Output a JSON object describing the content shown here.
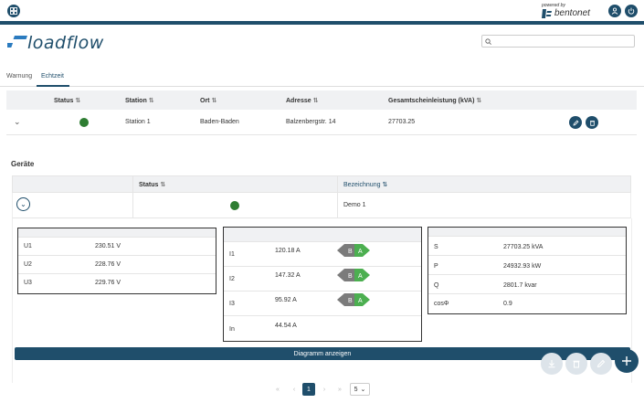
{
  "header": {
    "powered_by": "powered by",
    "brand": "bentonet",
    "app_name": "loadflow",
    "search_placeholder": ""
  },
  "tabs": [
    {
      "label": "Warnung",
      "active": false
    },
    {
      "label": "Echtzeit",
      "active": true
    }
  ],
  "stations_table": {
    "columns": [
      "Status",
      "Station",
      "Ort",
      "Adresse",
      "Gesamtscheinleistung (kVA)"
    ],
    "rows": [
      {
        "status": "green",
        "station": "Station 1",
        "ort": "Baden-Baden",
        "adresse": "Balzenbergstr. 14",
        "leistung": "27703.25"
      }
    ]
  },
  "devices": {
    "title": "Geräte",
    "columns": [
      "Status",
      "Bezeichnung"
    ],
    "rows": [
      {
        "status": "green",
        "bezeichnung": "Demo 1"
      }
    ]
  },
  "voltage": [
    {
      "label": "U1",
      "value": "230.51 V"
    },
    {
      "label": "U2",
      "value": "228.76 V"
    },
    {
      "label": "U3",
      "value": "229.76 V"
    }
  ],
  "current": [
    {
      "label": "I1",
      "value": "120.18 A",
      "badge_b": "B",
      "badge_a": "A"
    },
    {
      "label": "I2",
      "value": "147.32 A",
      "badge_b": "B",
      "badge_a": "A"
    },
    {
      "label": "I3",
      "value": "95.92 A",
      "badge_b": "B",
      "badge_a": "A"
    },
    {
      "label": "In",
      "value": "44.54 A"
    }
  ],
  "power": [
    {
      "label": "S",
      "value": "27703.25 kVA"
    },
    {
      "label": "P",
      "value": "24932.93 kW"
    },
    {
      "label": "Q",
      "value": "2801.7 kvar"
    },
    {
      "label": "cosΦ",
      "value": "0.9"
    }
  ],
  "diagram_button": "Diagramm anzeigen",
  "pagination": {
    "current_page": "1",
    "page_size": "5"
  },
  "colors": {
    "primary": "#1f4e6b",
    "status_ok": "#2e7d32",
    "badge_gray": "#7b7b7b",
    "badge_green": "#4caf50"
  }
}
